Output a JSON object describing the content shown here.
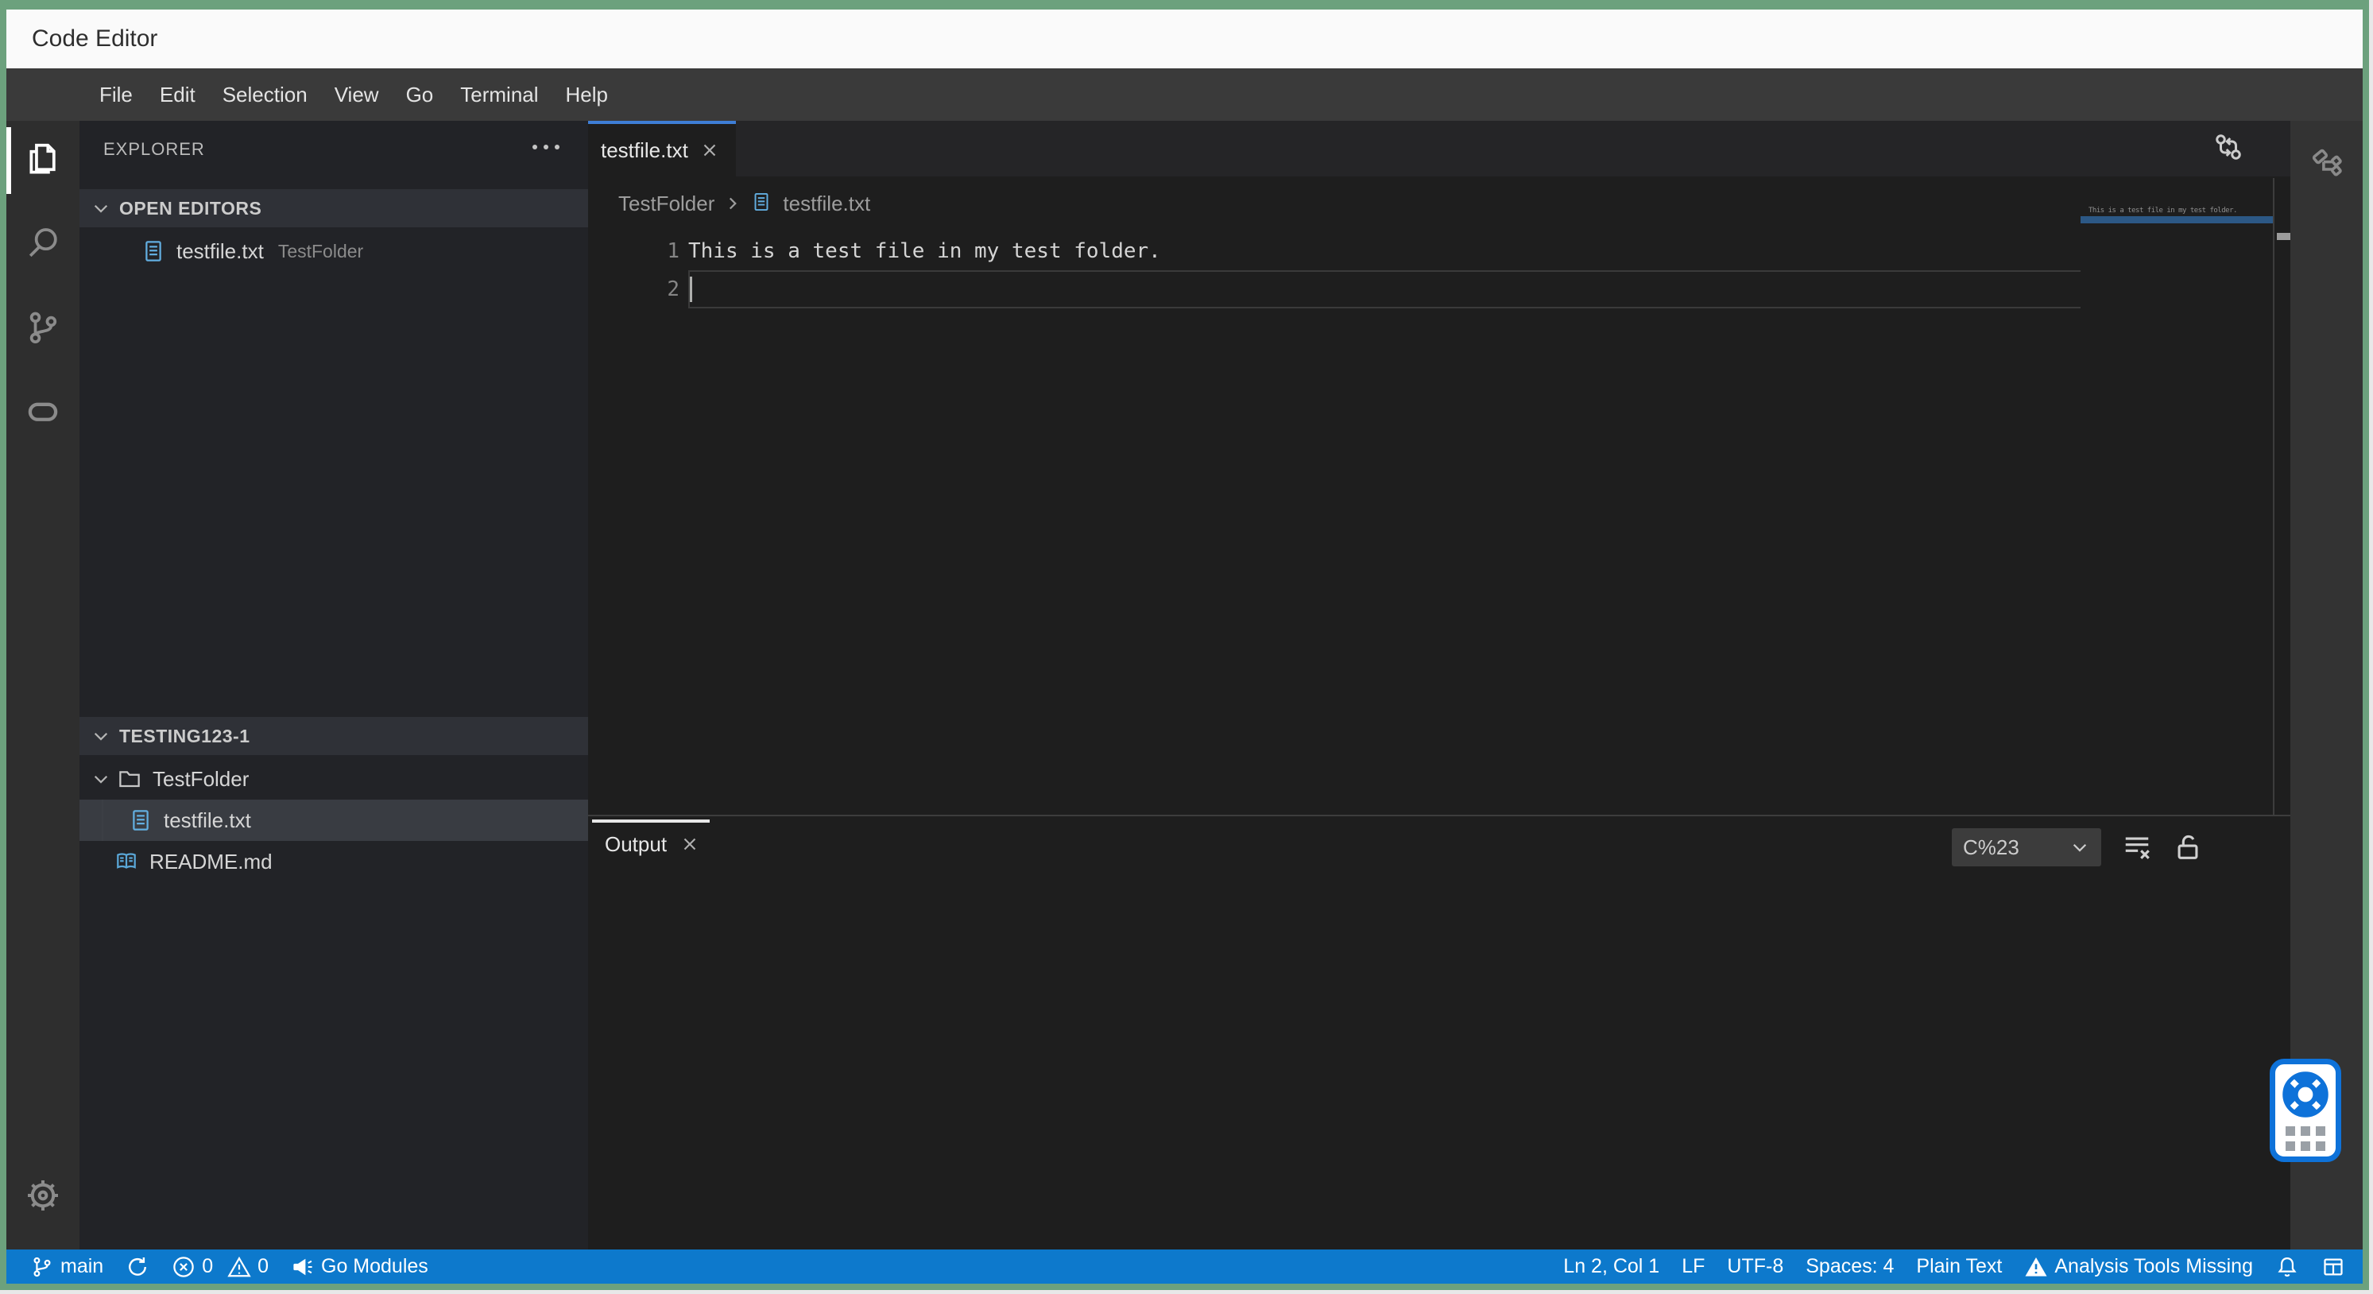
{
  "window": {
    "title": "Code Editor"
  },
  "menu": {
    "items": [
      "File",
      "Edit",
      "Selection",
      "View",
      "Go",
      "Terminal",
      "Help"
    ]
  },
  "explorer": {
    "title": "EXPLORER",
    "open_editors_label": "OPEN EDITORS",
    "open_editor_file": "testfile.txt",
    "open_editor_detail": "TestFolder",
    "workspace_label": "TESTING123-1",
    "folder_name": "TestFolder",
    "selected_file": "testfile.txt",
    "readme_file": "README.md"
  },
  "editor": {
    "tab_label": "testfile.txt",
    "breadcrumb_folder": "TestFolder",
    "breadcrumb_file": "testfile.txt",
    "line1_number": "1",
    "line2_number": "2",
    "line1_text": "This is a test file in my test folder.",
    "minimap_text": "This is a test file in my test folder."
  },
  "panel": {
    "tab_label": "Output",
    "channel_value": "C%23"
  },
  "status": {
    "branch": "main",
    "errors": "0",
    "warnings": "0",
    "go_modules": "Go Modules",
    "cursor_position": "Ln 2, Col 1",
    "eol": "LF",
    "encoding": "UTF-8",
    "indentation": "Spaces: 4",
    "language": "Plain Text",
    "analysis_warning": "Analysis Tools Missing"
  },
  "colors": {
    "window_border": "#6ca17d",
    "status_bar": "#0d79cc",
    "active_tab_accent": "#3e7ed6",
    "widget_accent": "#0e72d9",
    "file_icon": "#62aee0"
  }
}
